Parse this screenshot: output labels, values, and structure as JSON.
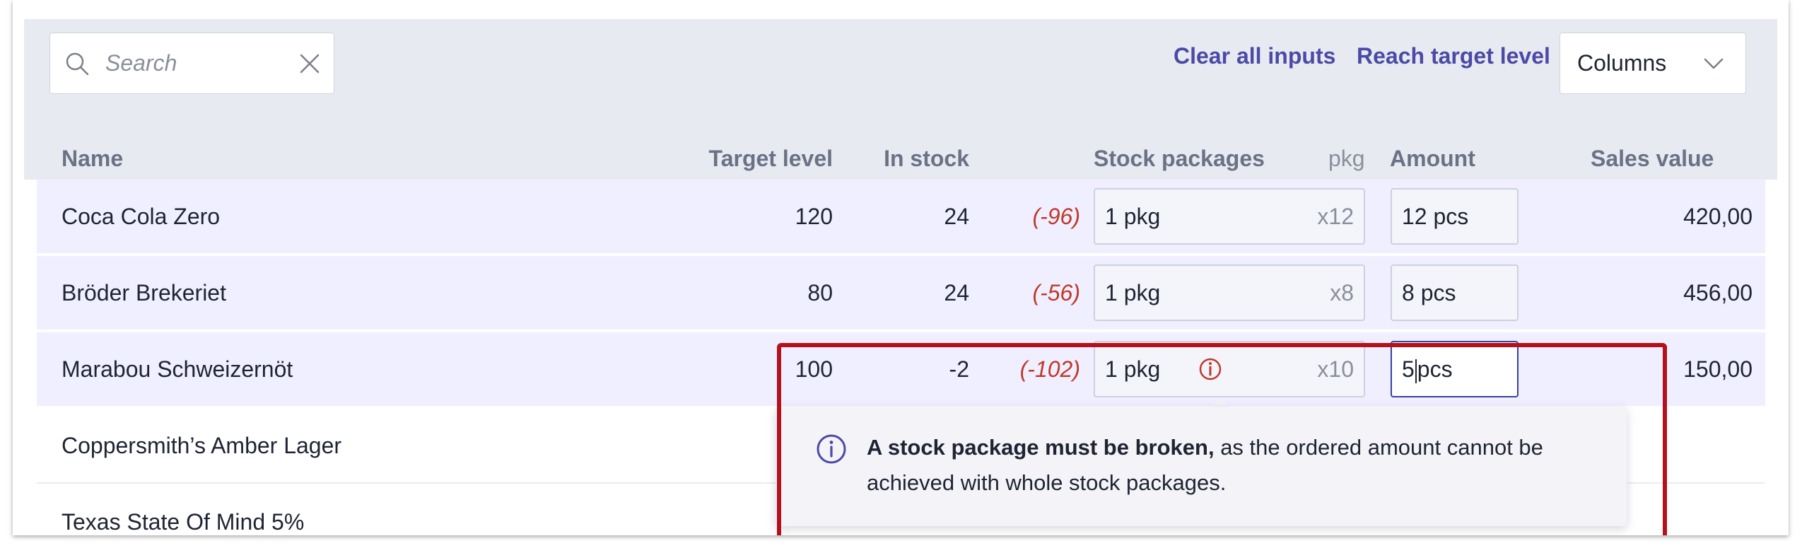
{
  "toolbar": {
    "search_placeholder": "Search",
    "clear_all_label": "Clear all inputs",
    "reach_target_label": "Reach target level",
    "columns_label": "Columns"
  },
  "table": {
    "headers": {
      "name": "Name",
      "target": "Target level",
      "stock": "In stock",
      "packages": "Stock packages",
      "pkg": "pkg",
      "amount": "Amount",
      "sales": "Sales value"
    },
    "rows": [
      {
        "name": "Coca Cola Zero",
        "target": "120",
        "stock": "24",
        "diff": "(-96)",
        "pkg": "1 pkg",
        "mult": "x12",
        "amount": "12 pcs",
        "sales": "420,00"
      },
      {
        "name": "Bröder Brekeriet",
        "target": "80",
        "stock": "24",
        "diff": "(-56)",
        "pkg": "1 pkg",
        "mult": "x8",
        "amount": "8 pcs",
        "sales": "456,00"
      },
      {
        "name": "Marabou Schweizernöt",
        "target": "100",
        "stock": "-2",
        "diff": "(-102)",
        "pkg": "1 pkg",
        "mult": "x10",
        "amount_num": "5",
        "amount_unit": "pcs",
        "sales": "150,00"
      },
      {
        "name": "Coppersmith’s Amber Lager"
      },
      {
        "name": "Texas State Of Mind 5%"
      }
    ]
  },
  "tooltip": {
    "bold": "A stock package must be broken,",
    "text": " as the ordered amount cannot be achieved with whole stock packages."
  },
  "colors": {
    "accent": "#4b4aa6",
    "highlight_border": "#b3121c",
    "negative": "#c0392b",
    "row_highlight": "#f0efff"
  }
}
